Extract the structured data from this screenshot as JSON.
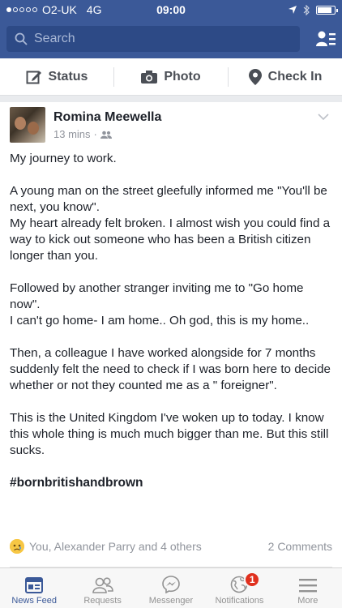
{
  "status_bar": {
    "carrier": "O2-UK",
    "network": "4G",
    "time": "09:00"
  },
  "search": {
    "placeholder": "Search"
  },
  "composer": {
    "status_label": "Status",
    "photo_label": "Photo",
    "checkin_label": "Check In"
  },
  "post": {
    "author": "Romina Meewella",
    "time": "13 mins",
    "paragraphs": [
      "My journey to work.",
      "A young man on the street gleefully informed me \"You'll be next, you know\".\nMy heart already felt broken. I almost wish you could find a way to kick out someone who has been a British citizen longer than you.",
      "Followed by another stranger inviting me to \"Go home now\".\nI can't go home- I am home.. Oh god, this is my home..",
      "Then, a colleague I have worked alongside for 7 months suddenly felt the need to check if I was born here to decide whether or not they counted me as a \" foreigner\".",
      "This is the United Kingdom I've woken up to today. I know this whole thing is much much bigger than me. But this still sucks."
    ],
    "hashtag": "#bornbritishandbrown",
    "reactions_text": "You, Alexander Parry and 4 others",
    "comments_text": "2 Comments"
  },
  "tabs": [
    {
      "label": "News Feed",
      "icon": "news-feed-icon"
    },
    {
      "label": "Requests",
      "icon": "friend-requests-icon"
    },
    {
      "label": "Messenger",
      "icon": "messenger-icon"
    },
    {
      "label": "Notifications",
      "icon": "globe-icon",
      "badge": "1"
    },
    {
      "label": "More",
      "icon": "menu-icon"
    }
  ],
  "colors": {
    "brand": "#3b5998",
    "badge": "#e0301e"
  }
}
